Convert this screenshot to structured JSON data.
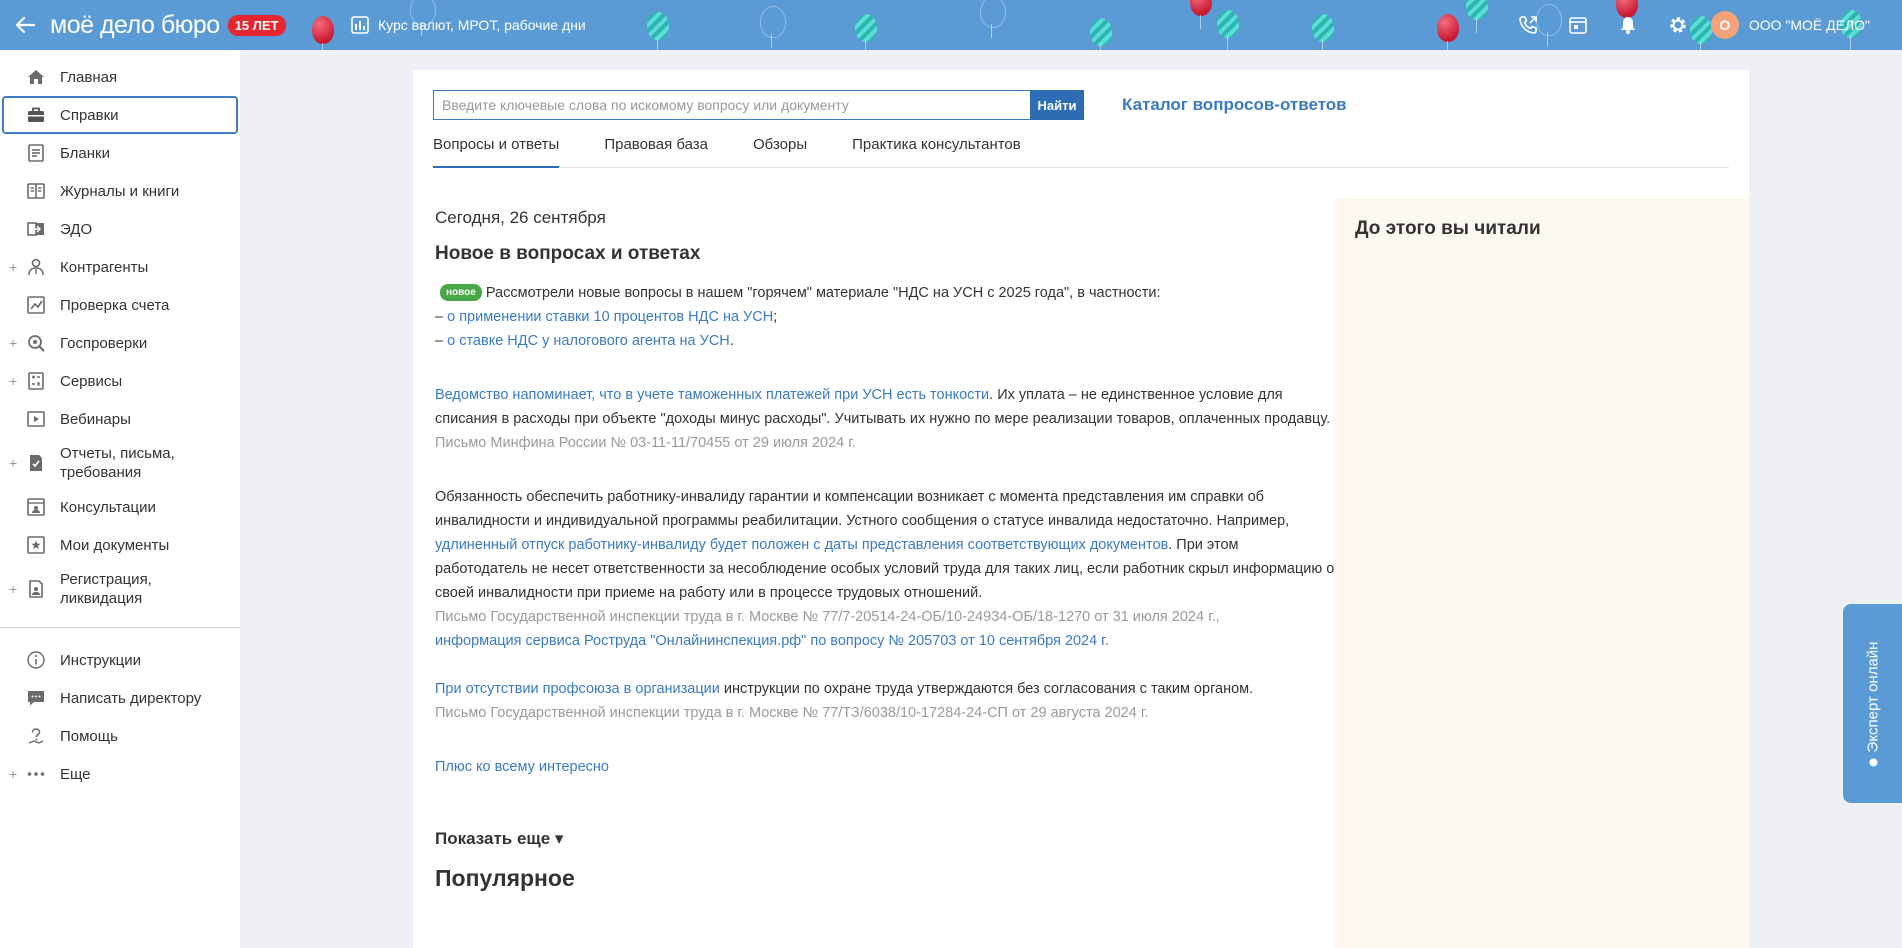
{
  "header": {
    "logo": "моё дело бюро",
    "anniversary_badge": "15 ЛЕТ",
    "rates_link": "Курс валют, МРОТ, рабочие дни",
    "org_avatar": "О",
    "org_name": "ООО \"МОЁ ДЕЛО\""
  },
  "sidebar": {
    "items": [
      {
        "label": "Главная"
      },
      {
        "label": "Справки"
      },
      {
        "label": "Бланки"
      },
      {
        "label": "Журналы и книги"
      },
      {
        "label": "ЭДО"
      },
      {
        "label": "Контрагенты"
      },
      {
        "label": "Проверка счета"
      },
      {
        "label": "Госпроверки"
      },
      {
        "label": "Сервисы"
      },
      {
        "label": "Вебинары"
      },
      {
        "label": "Отчеты, письма, требования"
      },
      {
        "label": "Консультации"
      },
      {
        "label": "Мои документы"
      },
      {
        "label": "Регистрация, ликвидация"
      }
    ],
    "bottom_items": [
      {
        "label": "Инструкции"
      },
      {
        "label": "Написать директору"
      },
      {
        "label": "Помощь"
      },
      {
        "label": "Еще"
      }
    ]
  },
  "search": {
    "placeholder": "Введите ключевые слова по искомому вопросу или документу",
    "button": "Найти",
    "catalog_link": "Каталог вопросов-ответов"
  },
  "tabs": [
    "Вопросы и ответы",
    "Правовая база",
    "Обзоры",
    "Практика консультантов"
  ],
  "feed": {
    "date": "Сегодня, 26 сентября",
    "section_title": "Новое в вопросах и ответах",
    "badge": "новое",
    "item1": {
      "intro": "Рассмотрели новые вопросы в нашем \"горячем\" материале \"НДС на УСН с 2025 года\", в частности:",
      "dash": "–",
      "link1": "о применении ставки 10 процентов НДС на УСН",
      "link1_end": ";",
      "link2": "о ставке НДС у налогового агента на УСН",
      "link2_end": "."
    },
    "item2": {
      "link": "Ведомство напоминает, что в учете таможенных платежей при УСН есть тонкости",
      "text": ". Их уплата – не единственное условие для списания в расходы при объекте \"доходы минус расходы\". Учитывать их нужно по мере реализации товаров, оплаченных продавцу.",
      "source": "Письмо Минфина России № 03-11-11/70455 от 29 июля 2024 г."
    },
    "item3": {
      "text1": "Обязанность обеспечить работнику-инвалиду гарантии и компенсации возникает с момента представления им справки об инвалидности и индивидуальной программы реабилитации. Устного сообщения о статусе инвалида недостаточно. Например, ",
      "link": "удлиненный отпуск работнику-инвалиду будет положен с даты представления соответствующих документов",
      "text2": ". При этом работодатель не несет ответственности за несоблюдение особых условий труда для таких лиц, если работник скрыл информацию о своей инвалидности при приеме на работу или в процессе трудовых отношений.",
      "source": "Письмо Государственной инспекции труда в г. Москве № 77/7-20514-24-ОБ/10-24934-ОБ/18-1270 от 31 июля 2024 г.,",
      "source_link": "информация сервиса Роструда \"Онлайнинспекция.рф\" по вопросу № 205703 от 10 сентября 2024 г."
    },
    "item4": {
      "link": "При отсутствии профсоюза в организации",
      "text": " инструкции по охране труда утверждаются без согласования с таким органом.",
      "source": "Письмо Государственной инспекции труда в г. Москве № 77/ТЗ/6038/10-17284-24-СП от 29 августа 2024 г."
    },
    "plus_link": "Плюс ко всему интересно",
    "show_more": "Показать еще ▾",
    "popular": "Популярное"
  },
  "aside": {
    "title": "До этого вы читали"
  },
  "expert": {
    "label": "Эксперт онлайн"
  },
  "colors": {
    "header": "#5b9bd5",
    "link": "#3a7bbf",
    "accent": "#2e6db4",
    "badge_red": "#e5252f",
    "badge_green": "#47a848"
  }
}
